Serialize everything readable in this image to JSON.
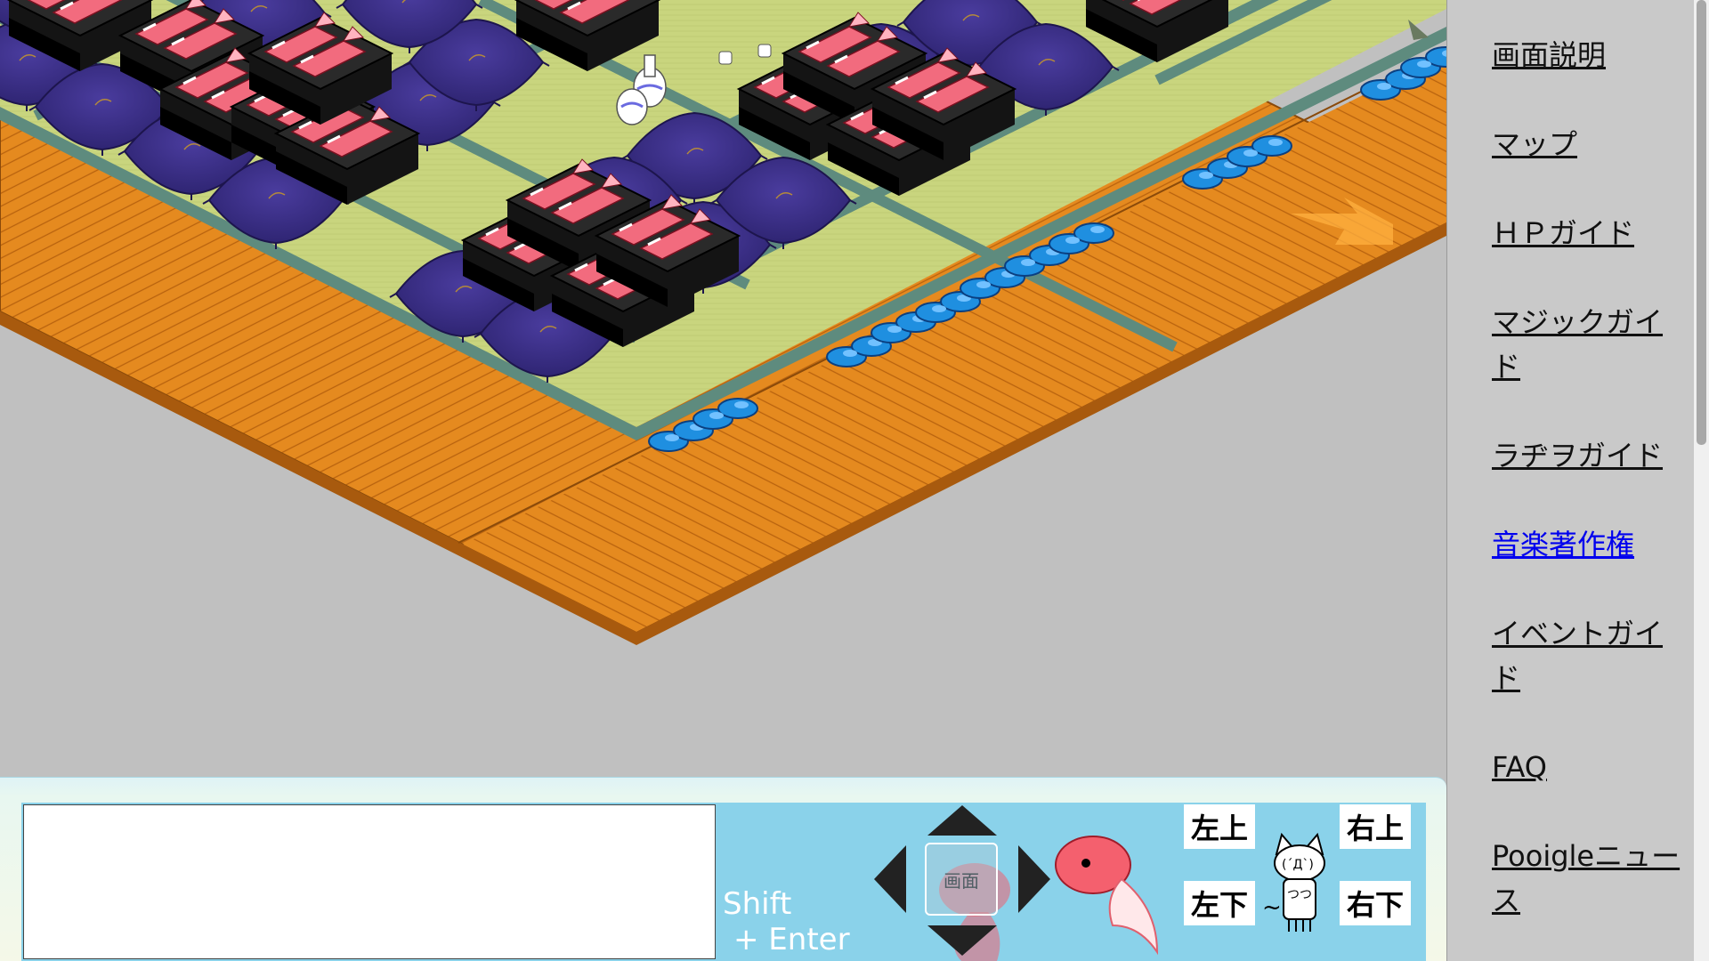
{
  "sidebar": {
    "items": [
      {
        "label": "画面説明"
      },
      {
        "label": "マップ"
      },
      {
        "label": "ＨＰガイド"
      },
      {
        "label": "マジックガイド"
      },
      {
        "label": "ラヂヲガイド"
      },
      {
        "label": "音楽著作権"
      },
      {
        "label": "イベントガイド"
      },
      {
        "label": "FAQ"
      },
      {
        "label": "Pooigleニュース"
      }
    ],
    "active_item": "音楽著作権",
    "link_color": "#0000ee"
  },
  "controls": {
    "chat_value": "",
    "send_hint_line1": "Shift",
    "send_hint_line2": "+ Enter",
    "screen_label": "画面",
    "dir_upper_left": "左上",
    "dir_upper_right": "右上",
    "dir_lower_left": "左下",
    "dir_lower_right": "右下",
    "tilde": "~"
  },
  "icons": [
    "arrow-up-icon",
    "arrow-down-icon",
    "arrow-left-icon",
    "arrow-right-icon",
    "goldfish-icon",
    "cat-mascot-icon",
    "exit-arrow-icon",
    "slippers-icon",
    "sake-bottle-icon",
    "sake-cup-icon",
    "zabuton-icon",
    "food-tray-icon"
  ],
  "colors": {
    "tatami": "#c9d57e",
    "tatami_border": "#5e8b7e",
    "wood_floor": "#e58a1f",
    "zabuton": "#3a2e86",
    "panel_blue": "#8ad2ea",
    "background": "#c0c0c0"
  }
}
